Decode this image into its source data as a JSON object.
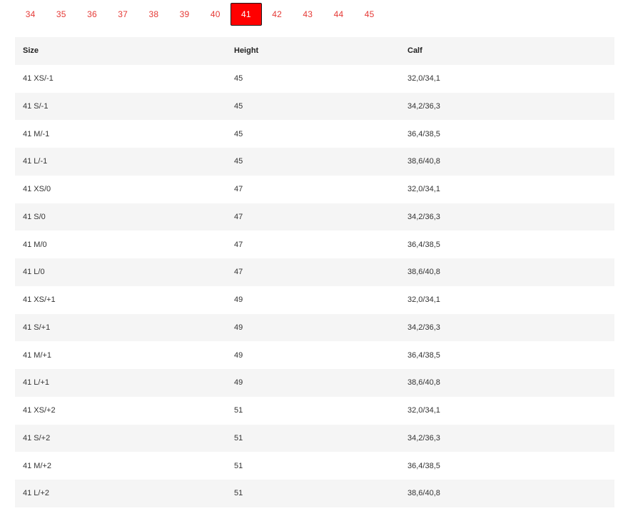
{
  "size_tabs": {
    "items": [
      "34",
      "35",
      "36",
      "37",
      "38",
      "39",
      "40",
      "41",
      "42",
      "43",
      "44",
      "45"
    ],
    "selected": "41"
  },
  "colors": {
    "accent": "#ff0000",
    "tab_text": "#e53935",
    "row_stripe": "#f5f5f5"
  },
  "table": {
    "headers": [
      "Size",
      "Height",
      "Calf"
    ],
    "rows": [
      [
        "41 XS/-1",
        "45",
        "32,0/34,1"
      ],
      [
        "41 S/-1",
        "45",
        "34,2/36,3"
      ],
      [
        "41 M/-1",
        "45",
        "36,4/38,5"
      ],
      [
        "41 L/-1",
        "45",
        "38,6/40,8"
      ],
      [
        "41 XS/0",
        "47",
        "32,0/34,1"
      ],
      [
        "41 S/0",
        "47",
        "34,2/36,3"
      ],
      [
        "41 M/0",
        "47",
        "36,4/38,5"
      ],
      [
        "41 L/0",
        "47",
        "38,6/40,8"
      ],
      [
        "41 XS/+1",
        "49",
        "32,0/34,1"
      ],
      [
        "41 S/+1",
        "49",
        "34,2/36,3"
      ],
      [
        "41 M/+1",
        "49",
        "36,4/38,5"
      ],
      [
        "41 L/+1",
        "49",
        "38,6/40,8"
      ],
      [
        "41 XS/+2",
        "51",
        "32,0/34,1"
      ],
      [
        "41 S/+2",
        "51",
        "34,2/36,3"
      ],
      [
        "41 M/+2",
        "51",
        "36,4/38,5"
      ],
      [
        "41 L/+2",
        "51",
        "38,6/40,8"
      ]
    ]
  }
}
